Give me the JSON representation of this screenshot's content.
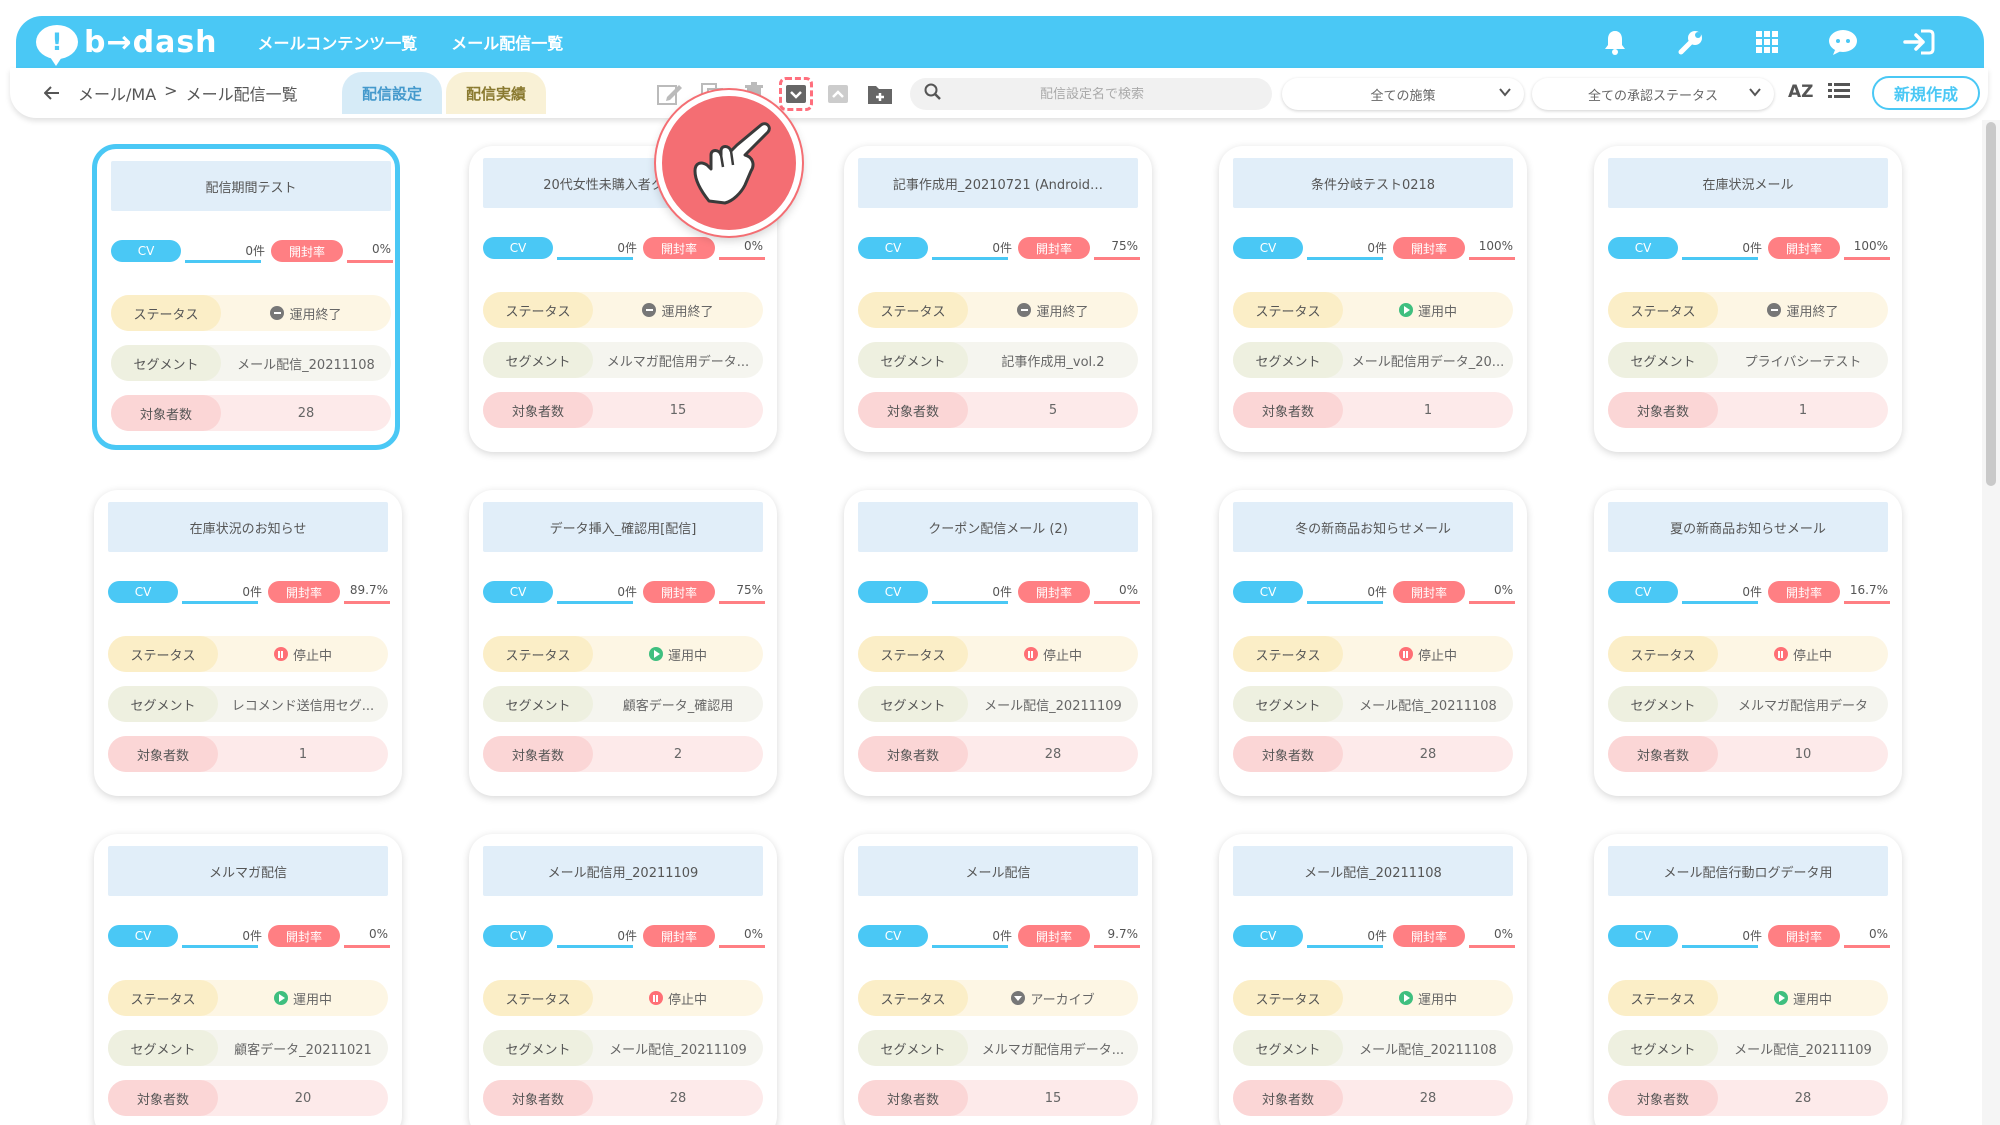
{
  "header": {
    "logo_text": "b→dash",
    "nav": [
      "メールコンテンツ一覧",
      "メール配信一覧"
    ],
    "icons": [
      "bell-icon",
      "wrench-icon",
      "grid-icon",
      "chat-icon",
      "logout-icon"
    ],
    "accent_color": "#4ac8f5"
  },
  "toolbar": {
    "back_icon": "arrow-left-icon",
    "breadcrumb": [
      "メール/MA",
      ">",
      "メール配信一覧"
    ],
    "tabs": [
      "配信設定",
      "配信実績"
    ],
    "tool_icons": [
      "edit-icon",
      "copy-icon",
      "delete-icon",
      "archive-icon",
      "unarchive-icon",
      "add-folder-icon"
    ],
    "search_placeholder": "配信設定名で検索",
    "measure_select": "全ての施策",
    "status_select": "全ての承認ステータス",
    "sort_label": "AZ",
    "new_button": "新規作成"
  },
  "labels": {
    "cv": "CV",
    "open_rate": "開封率",
    "status": "ステータス",
    "segment": "セグメント",
    "target": "対象者数"
  },
  "cards": [
    {
      "title": "配信期間テスト",
      "cv": "0件",
      "open": "0%",
      "status": "運用終了",
      "status_type": "ended",
      "segment": "メール配信_20211108",
      "target": "28",
      "selected": true
    },
    {
      "title": "20代女性未購入者クーポン",
      "cv": "0件",
      "open": "0%",
      "status": "運用終了",
      "status_type": "ended",
      "segment": "メルマガ配信用データ...",
      "target": "15"
    },
    {
      "title": "記事作成用_20210721 (Android…",
      "cv": "0件",
      "open": "75%",
      "status": "運用終了",
      "status_type": "ended",
      "segment": "記事作成用_vol.2",
      "target": "5"
    },
    {
      "title": "条件分岐テスト0218",
      "cv": "0件",
      "open": "100%",
      "status": "運用中",
      "status_type": "running",
      "segment": "メール配信用データ_20...",
      "target": "1"
    },
    {
      "title": "在庫状況メール",
      "cv": "0件",
      "open": "100%",
      "status": "運用終了",
      "status_type": "ended",
      "segment": "プライバシーテスト",
      "target": "1"
    },
    {
      "title": "在庫状況のお知らせ",
      "cv": "0件",
      "open": "89.7%",
      "status": "停止中",
      "status_type": "stopped",
      "segment": "レコメンド送信用セグ...",
      "target": "1"
    },
    {
      "title": "データ挿入_確認用[配信]",
      "cv": "0件",
      "open": "75%",
      "status": "運用中",
      "status_type": "running",
      "segment": "顧客データ_確認用",
      "target": "2"
    },
    {
      "title": "クーポン配信メール (2)",
      "cv": "0件",
      "open": "0%",
      "status": "停止中",
      "status_type": "stopped",
      "segment": "メール配信_20211109",
      "target": "28"
    },
    {
      "title": "冬の新商品お知らせメール",
      "cv": "0件",
      "open": "0%",
      "status": "停止中",
      "status_type": "stopped",
      "segment": "メール配信_20211108",
      "target": "28"
    },
    {
      "title": "夏の新商品お知らせメール",
      "cv": "0件",
      "open": "16.7%",
      "status": "停止中",
      "status_type": "stopped",
      "segment": "メルマガ配信用データ",
      "target": "10"
    },
    {
      "title": "メルマガ配信",
      "cv": "0件",
      "open": "0%",
      "status": "運用中",
      "status_type": "running",
      "segment": "顧客データ_20211021",
      "target": "20"
    },
    {
      "title": "メール配信用_20211109",
      "cv": "0件",
      "open": "0%",
      "status": "停止中",
      "status_type": "stopped",
      "segment": "メール配信_20211109",
      "target": "28"
    },
    {
      "title": "メール配信",
      "cv": "0件",
      "open": "9.7%",
      "status": "アーカイブ",
      "status_type": "archived",
      "segment": "メルマガ配信用データ...",
      "target": "15"
    },
    {
      "title": "メール配信_20211108",
      "cv": "0件",
      "open": "0%",
      "status": "運用中",
      "status_type": "running",
      "segment": "メール配信_20211108",
      "target": "28"
    },
    {
      "title": "メール配信行動ログデータ用",
      "cv": "0件",
      "open": "0%",
      "status": "運用中",
      "status_type": "running",
      "segment": "メール配信_20211109",
      "target": "28"
    }
  ]
}
